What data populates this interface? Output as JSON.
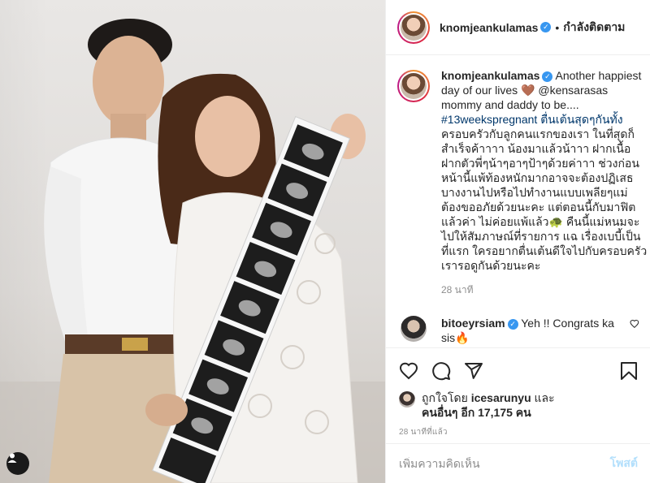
{
  "header": {
    "username": "knomjeankulamas",
    "separator": "•",
    "follow_status": "กำลังติดตาม"
  },
  "caption": {
    "username": "knomjeankulamas",
    "lines": [
      "Another happiest",
      "day of our lives 🤎 @kensarasas",
      "mommy and daddy to be....",
      "#13weekspregnant ตื่นเต้นสุดๆกันทั้ง",
      "ครอบครัวกับลูกคนแรกของเรา ในที่สุดก็",
      "สำเร็จค้าาาา น้องมาแล้วน้าาา ฝากเนื้อ",
      "ฝากตัวพี่ๆน้าๆอาๆป้าๆด้วยค่าาา ช่วงก่อน",
      "หน้านี้แพ้ท้องหนักมากอาจจะต้องปฏิเสธ",
      "บางงานไปหรือไปทำงานแบบเพลียๆแม่",
      "ต้องขออภัยด้วยนะคะ แต่ตอนนี้กับมาฟิต",
      "แล้วค่า ไม่ค่อยแพ้แล้ว🐢 คืนนี้แม่หนมจะ",
      "ไปให้สัมภาษณ์ที่รายการ แฉ เรื่องเบบี้เป็น",
      "ที่แรก ใครอยากตื่นเต้นดีใจไปกับครอบครัว",
      "เรารอดูกันด้วยนะคะ"
    ],
    "time_ago": "28 นาที"
  },
  "comment": {
    "username": "bitoeyrsiam",
    "text": "Yeh !! Congrats ka",
    "text_cont": "sis🔥"
  },
  "likes": {
    "prefix": "ถูกใจโดย",
    "first_user": "icesarunyu",
    "and": "และ",
    "others": "คนอื่นๆ อีก 17,175 คน"
  },
  "post_time": "28 นาทีที่แล้ว",
  "add_comment": {
    "placeholder": "เพิ่มความคิดเห็น",
    "post_label": "โพสต์"
  },
  "icons": {
    "like": "heart-icon",
    "comment": "comment-icon",
    "share": "share-icon",
    "save": "bookmark-icon",
    "user_tag": "user-tag-icon"
  },
  "colors": {
    "text": "#262626",
    "secondary": "#8e8e8e",
    "link": "#00376b",
    "verified": "#3897f0",
    "post_disabled": "#b2dffc"
  }
}
